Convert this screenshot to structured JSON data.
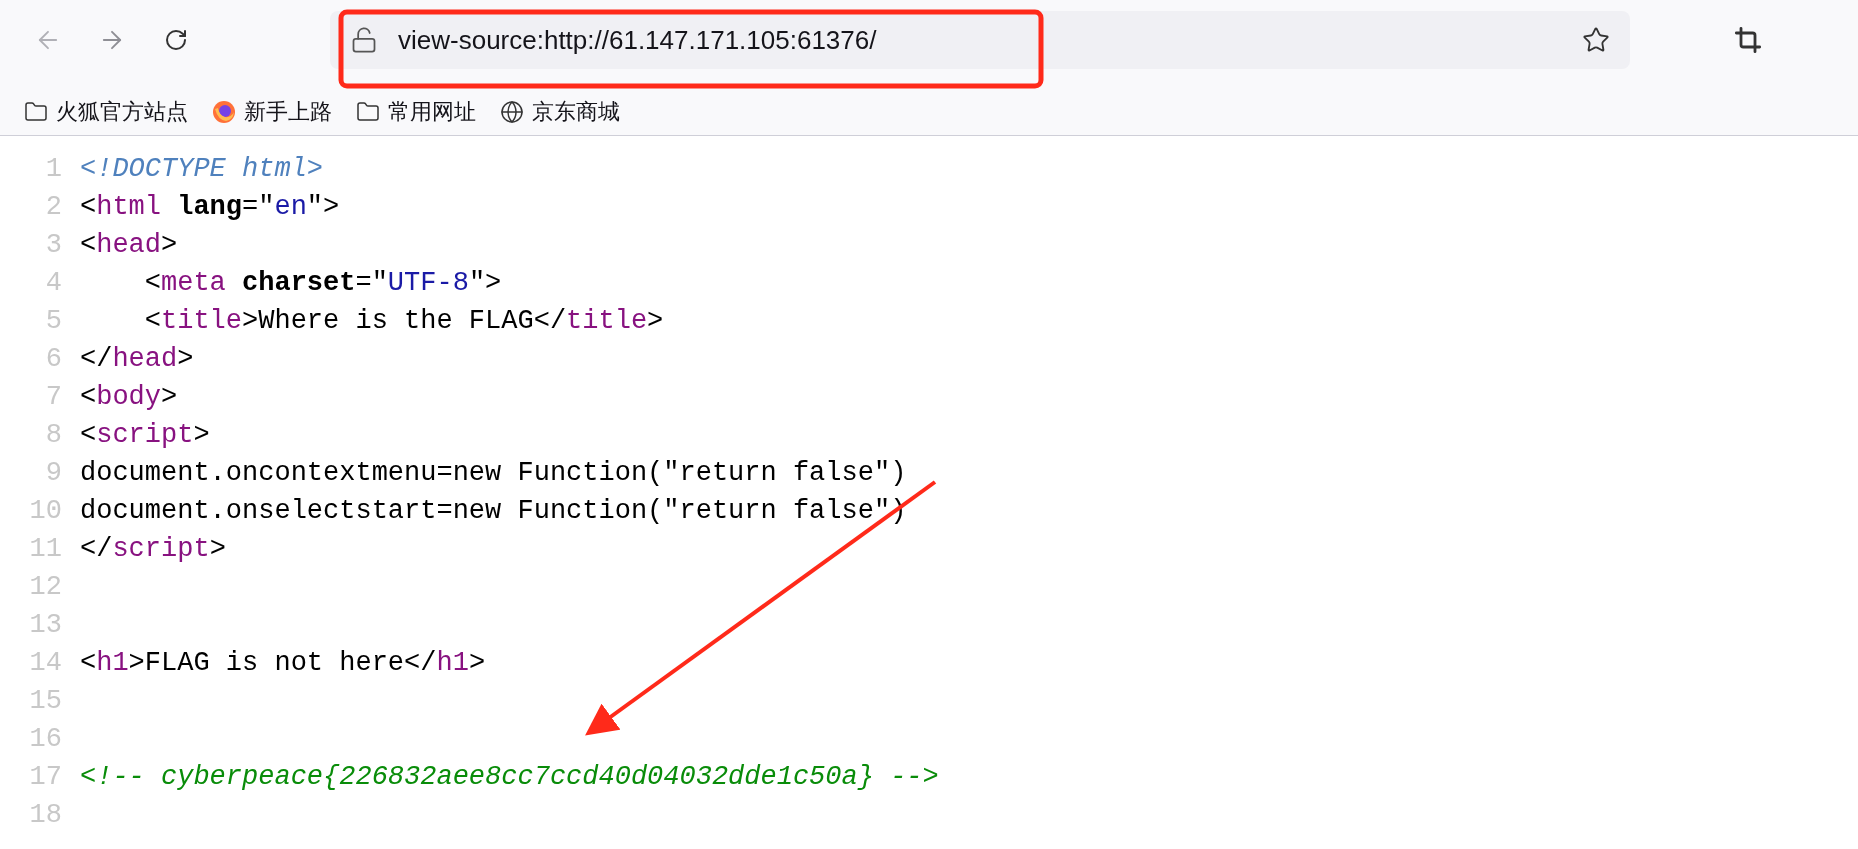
{
  "toolbar": {
    "url": "view-source:http://61.147.171.105:61376/"
  },
  "bookmarks": [
    {
      "label": "火狐官方站点",
      "kind": "folder"
    },
    {
      "label": "新手上路",
      "kind": "firefox"
    },
    {
      "label": "常用网址",
      "kind": "folder"
    },
    {
      "label": "京东商城",
      "kind": "globe"
    }
  ],
  "source_lines": [
    {
      "number": "1",
      "tokens": [
        {
          "kind": "doctype",
          "text": "<!DOCTYPE html>"
        }
      ]
    },
    {
      "number": "2",
      "tokens": [
        {
          "kind": "plain",
          "text": "<"
        },
        {
          "kind": "tag",
          "text": "html"
        },
        {
          "kind": "attr",
          "text": " lang"
        },
        {
          "kind": "plain",
          "text": "=\""
        },
        {
          "kind": "value",
          "text": "en"
        },
        {
          "kind": "plain",
          "text": "\">"
        }
      ]
    },
    {
      "number": "3",
      "tokens": [
        {
          "kind": "plain",
          "text": "<"
        },
        {
          "kind": "tag",
          "text": "head"
        },
        {
          "kind": "plain",
          "text": ">"
        }
      ]
    },
    {
      "number": "4",
      "tokens": [
        {
          "kind": "plain",
          "text": "    <"
        },
        {
          "kind": "tag",
          "text": "meta"
        },
        {
          "kind": "attr",
          "text": " charset"
        },
        {
          "kind": "plain",
          "text": "=\""
        },
        {
          "kind": "value",
          "text": "UTF-8"
        },
        {
          "kind": "plain",
          "text": "\">"
        }
      ]
    },
    {
      "number": "5",
      "tokens": [
        {
          "kind": "plain",
          "text": "    <"
        },
        {
          "kind": "tag",
          "text": "title"
        },
        {
          "kind": "plain",
          "text": ">Where is the FLAG</"
        },
        {
          "kind": "tag",
          "text": "title"
        },
        {
          "kind": "plain",
          "text": ">"
        }
      ]
    },
    {
      "number": "6",
      "tokens": [
        {
          "kind": "plain",
          "text": "</"
        },
        {
          "kind": "tag",
          "text": "head"
        },
        {
          "kind": "plain",
          "text": ">"
        }
      ]
    },
    {
      "number": "7",
      "tokens": [
        {
          "kind": "plain",
          "text": "<"
        },
        {
          "kind": "tag",
          "text": "body"
        },
        {
          "kind": "plain",
          "text": ">"
        }
      ]
    },
    {
      "number": "8",
      "tokens": [
        {
          "kind": "plain",
          "text": "<"
        },
        {
          "kind": "tag",
          "text": "script"
        },
        {
          "kind": "plain",
          "text": ">"
        }
      ]
    },
    {
      "number": "9",
      "tokens": [
        {
          "kind": "plain",
          "text": "document.oncontextmenu=new Function(\"return false\")"
        }
      ]
    },
    {
      "number": "10",
      "tokens": [
        {
          "kind": "plain",
          "text": "document.onselectstart=new Function(\"return false\")"
        }
      ]
    },
    {
      "number": "11",
      "tokens": [
        {
          "kind": "plain",
          "text": "</"
        },
        {
          "kind": "tag",
          "text": "script"
        },
        {
          "kind": "plain",
          "text": ">"
        }
      ]
    },
    {
      "number": "12"
    },
    {
      "number": "13"
    },
    {
      "number": "14",
      "tokens": [
        {
          "kind": "plain",
          "text": "<"
        },
        {
          "kind": "tag",
          "text": "h1"
        },
        {
          "kind": "plain",
          "text": ">FLAG is not here</"
        },
        {
          "kind": "tag",
          "text": "h1"
        },
        {
          "kind": "plain",
          "text": ">"
        }
      ]
    },
    {
      "number": "15"
    },
    {
      "number": "16"
    },
    {
      "number": "17",
      "tokens": [
        {
          "kind": "comment",
          "text": "<!-- cyberpeace{226832aee8cc7ccd40d04032dde1c50a} -->"
        }
      ]
    },
    {
      "number": "18"
    }
  ]
}
